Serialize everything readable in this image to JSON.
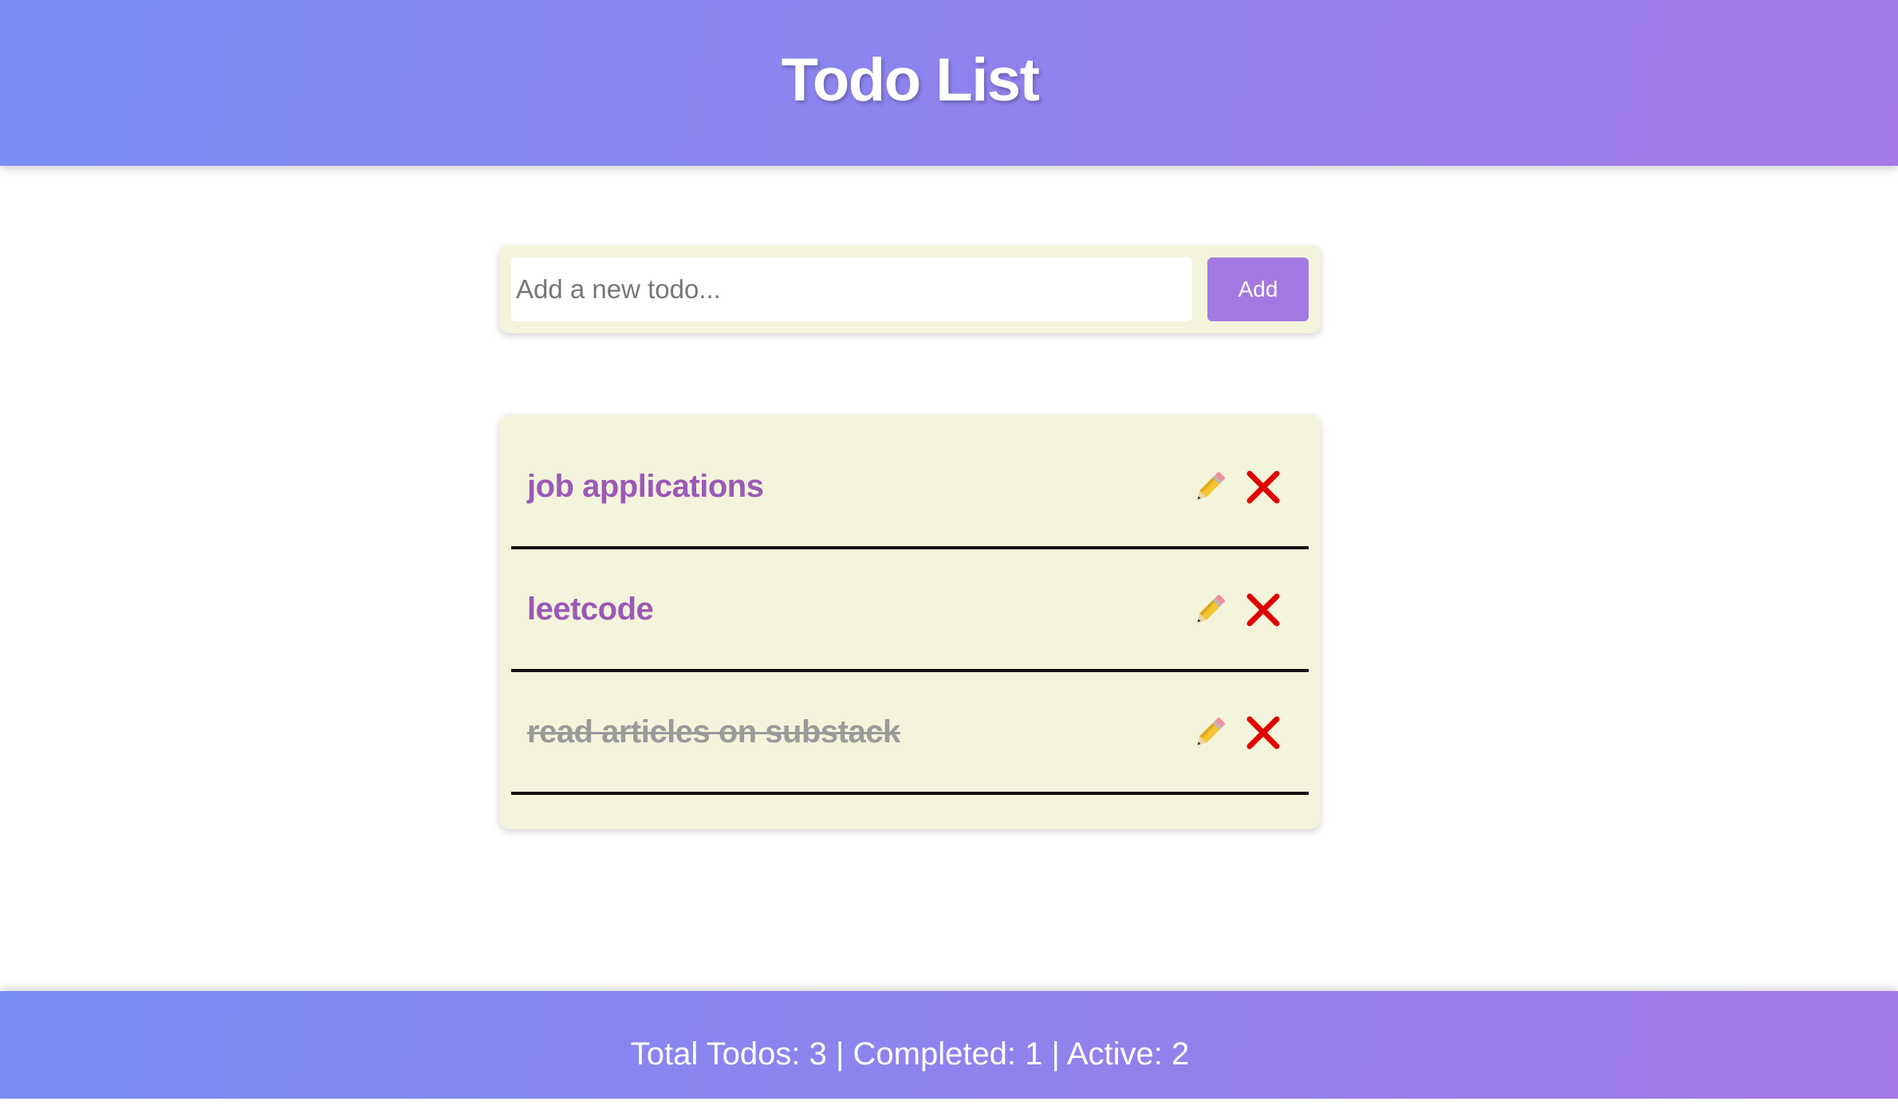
{
  "header": {
    "title": "Todo List"
  },
  "add_form": {
    "placeholder": "Add a new todo...",
    "value": "",
    "add_label": "Add"
  },
  "todos": [
    {
      "text": "job applications",
      "completed": false
    },
    {
      "text": "leetcode",
      "completed": false
    },
    {
      "text": "read articles on substack",
      "completed": true
    }
  ],
  "icons": {
    "edit": "pencil-icon",
    "delete": "close-icon"
  },
  "footer": {
    "stats": "Total Todos: 3 | Completed: 1 | Active: 2"
  },
  "colors": {
    "gradient_start": "#7a8df5",
    "gradient_end": "#a37ae4",
    "card_bg": "#f4f4dc",
    "todo_text": "#9b59b6",
    "completed_text": "#9a9a9a",
    "add_button": "#a379e1",
    "delete_icon": "#e00000"
  }
}
